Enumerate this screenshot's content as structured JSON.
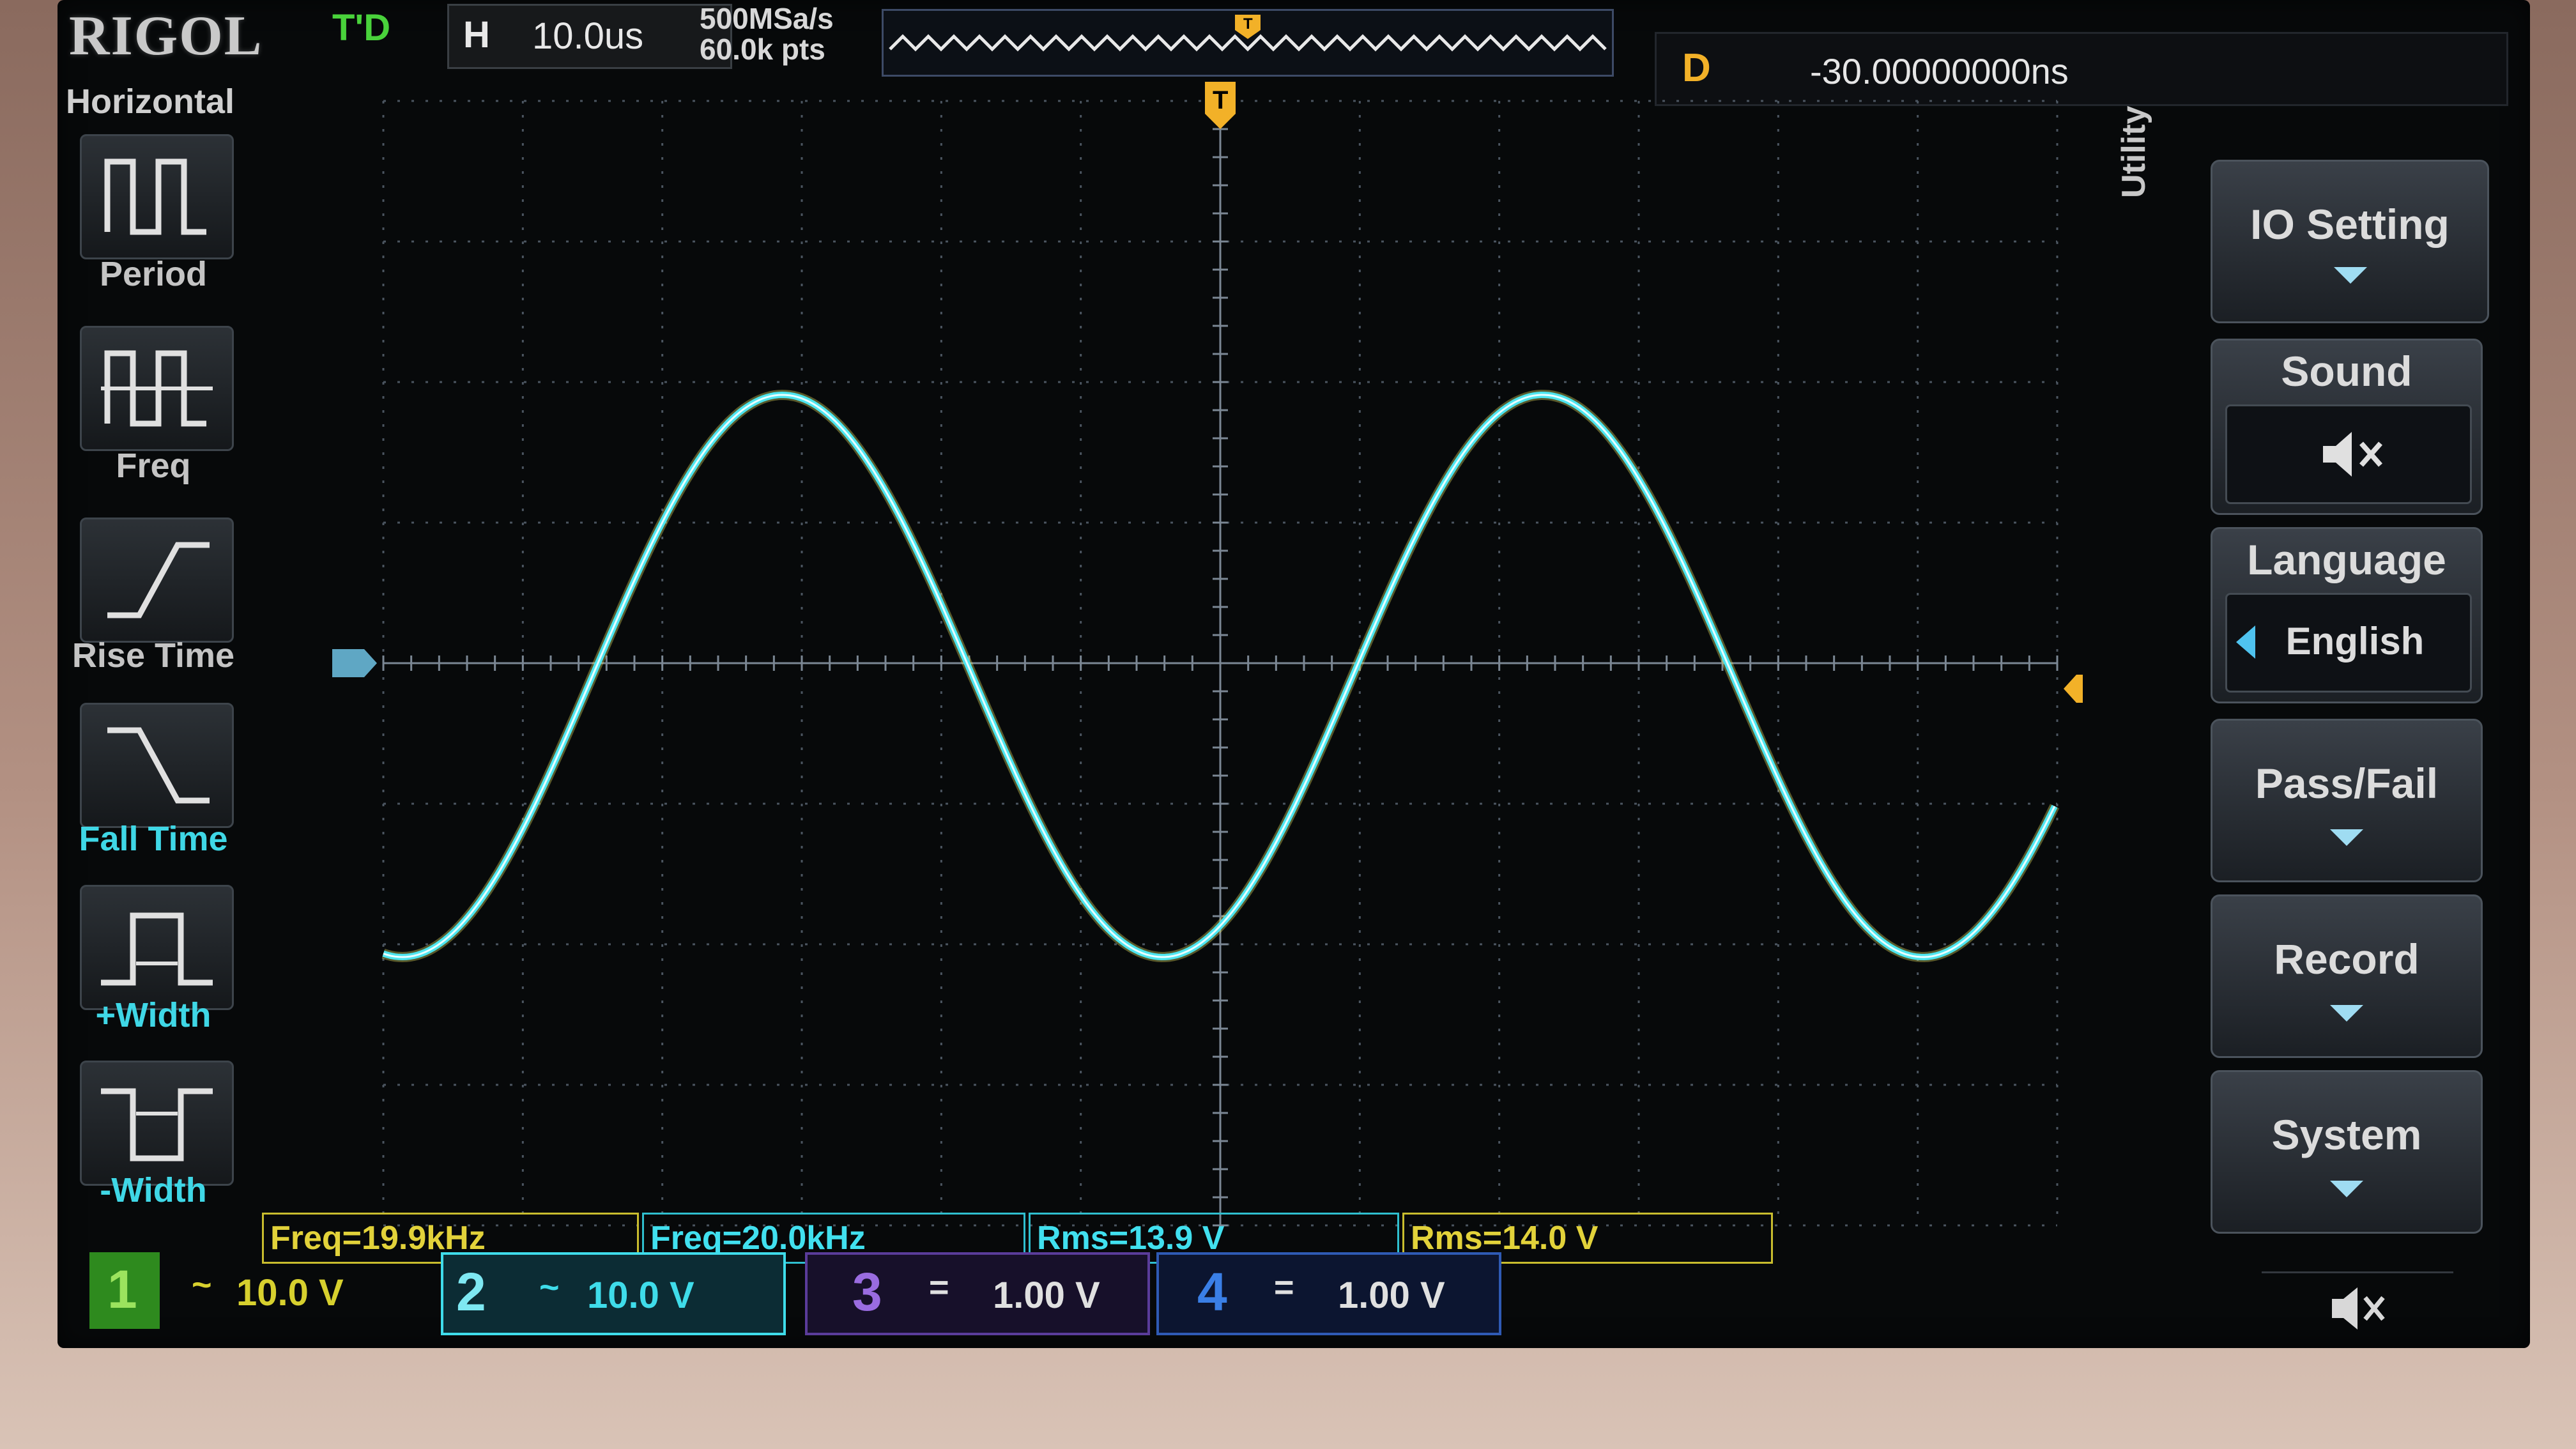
{
  "brand": "RIGOL",
  "run_state": "T'D",
  "horizontal": {
    "label": "H",
    "timebase": "10.0us"
  },
  "acquisition": {
    "sample_rate": "500MSa/s",
    "memory_depth": "60.0k pts"
  },
  "trigger": {
    "delay_label": "D",
    "delay_value": "-30.00000000ns",
    "marker": "T"
  },
  "measure_menu": {
    "title": "Horizontal",
    "items": [
      {
        "label": "Period"
      },
      {
        "label": "Freq"
      },
      {
        "label": "Rise Time"
      },
      {
        "label": "Fall Time"
      },
      {
        "label": "+Width"
      },
      {
        "label": "-Width"
      }
    ]
  },
  "utility_menu": {
    "title": "Utility",
    "items": [
      {
        "label": "IO Setting"
      },
      {
        "label": "Sound"
      },
      {
        "label": "Language",
        "value": "English"
      },
      {
        "label": "Pass/Fail"
      },
      {
        "label": "Record"
      },
      {
        "label": "System"
      }
    ]
  },
  "measurements": [
    {
      "text": "Freq=19.9kHz",
      "color": "#e2d23a"
    },
    {
      "text": "Freq=20.0kHz",
      "color": "#41e0ef"
    },
    {
      "text": "Rms=13.9 V",
      "color": "#41e0ef"
    },
    {
      "text": "Rms=14.0 V",
      "color": "#e2d23a"
    }
  ],
  "channels": [
    {
      "num": "1",
      "coupling": "~",
      "scale": "10.0 V",
      "color": "#d7d02e"
    },
    {
      "num": "2",
      "coupling": "~",
      "scale": "10.0 V",
      "color": "#3fdcea"
    },
    {
      "num": "3",
      "coupling": "=",
      "scale": "1.00 V",
      "color": "#9a6ce0"
    },
    {
      "num": "4",
      "coupling": "=",
      "scale": "1.00 V",
      "color": "#3a7fe6"
    }
  ],
  "colors": {
    "trace": "#4ee6f0",
    "grid": "#4b5560",
    "trigger": "#f2b128"
  }
}
